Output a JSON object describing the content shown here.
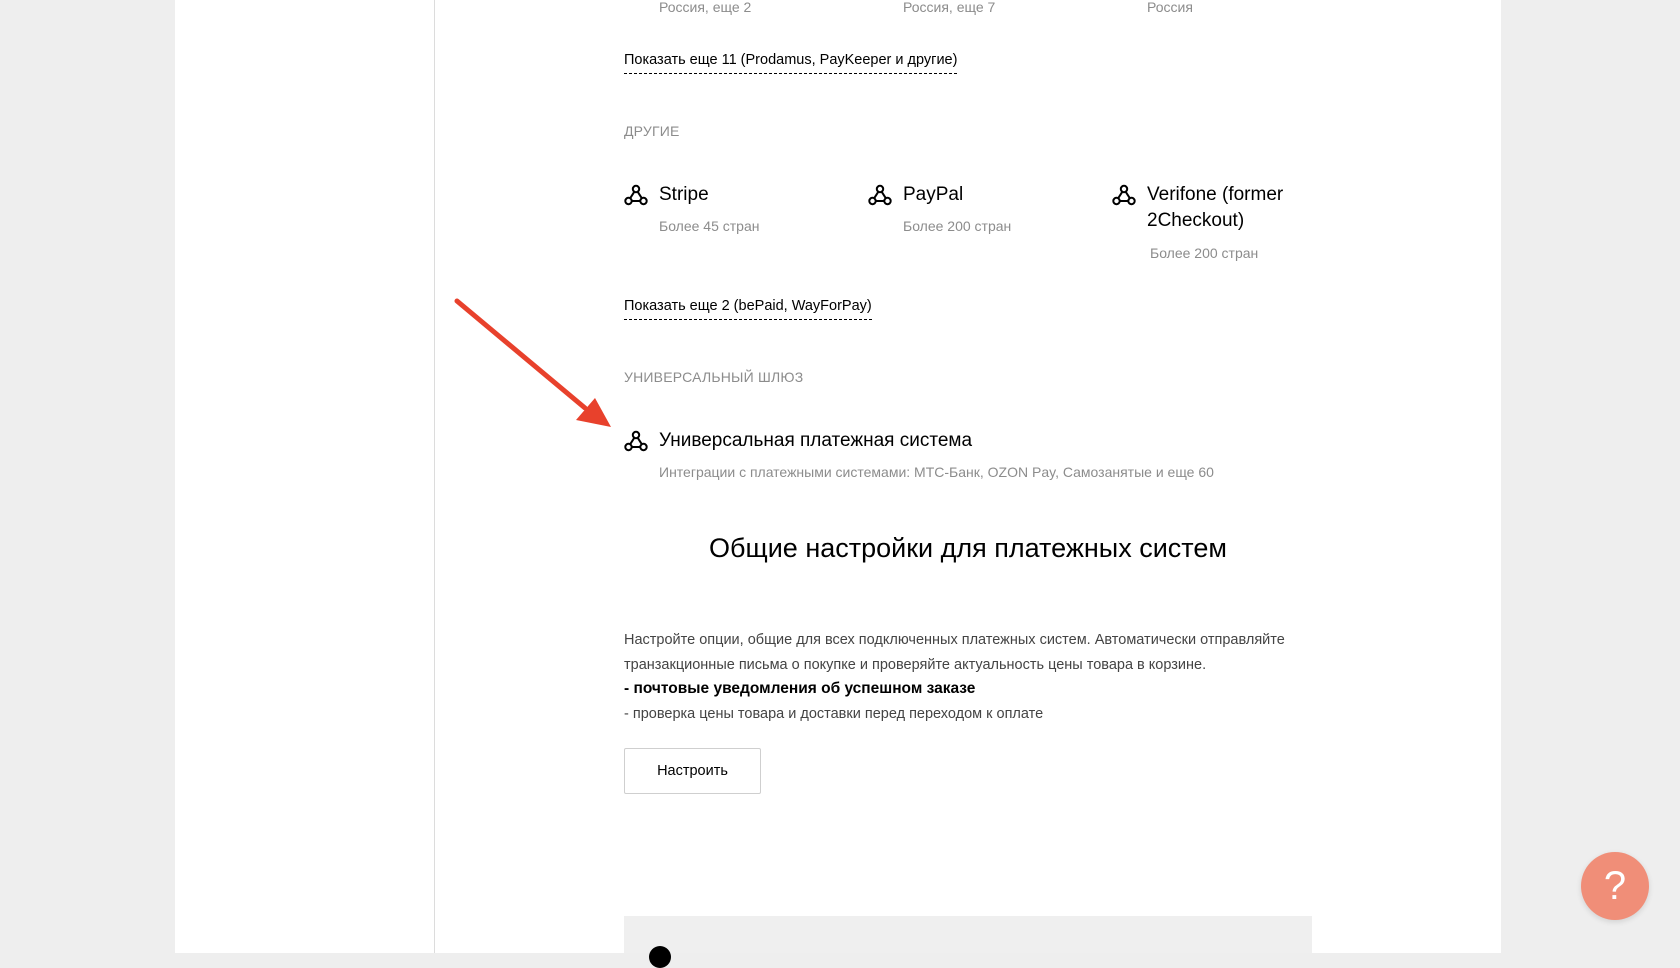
{
  "colors": {
    "background": "#eeeeee",
    "panel": "#ffffff",
    "muted_text": "#8c8c8c",
    "help_button": "#f08e78",
    "annotation_arrow": "#e8412c"
  },
  "top_row": {
    "subtitles": [
      "Россия, еще 2",
      "Россия, еще 7",
      "Россия"
    ]
  },
  "show_more_russia": "Показать еще 11 (Prodamus, PayKeeper и другие)",
  "other": {
    "title": "ДРУГИЕ",
    "providers": [
      {
        "name": "Stripe",
        "desc": "Более 45 стран",
        "icon": "webhook-icon"
      },
      {
        "name": "PayPal",
        "desc": "Более 200 стран",
        "icon": "webhook-icon"
      },
      {
        "name": "Verifone (former 2Checkout)",
        "desc": "Более 200 стран",
        "icon": "webhook-icon"
      }
    ],
    "show_more": "Показать еще 2 (bePaid, WayForPay)"
  },
  "universal": {
    "title": "УНИВЕРСАЛЬНЫЙ ШЛЮЗ",
    "name": "Универсальная платежная система",
    "desc": "Интеграции с платежными системами: МТС-Банк, OZON Pay, Самозанятые и еще 60",
    "icon": "webhook-icon"
  },
  "general": {
    "title": "Общие настройки для платежных систем",
    "desc_line1": "Настройте опции, общие для всех подключенных платежных систем. Автоматически отправляйте",
    "desc_line2": "транзакционные письма о покупке и проверяйте актуальность цены товара в корзине.",
    "bullet1": "- почтовые уведомления об успешном заказе",
    "bullet2": "- проверка цены товара и доставки перед переходом к оплате",
    "button_label": "Настроить"
  },
  "help": {
    "label": "?"
  }
}
